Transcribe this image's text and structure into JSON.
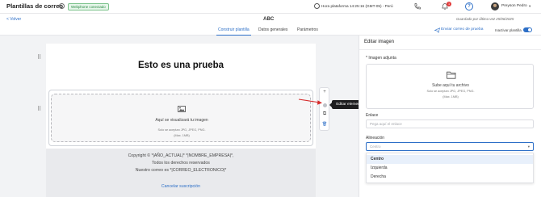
{
  "header": {
    "app_title": "Plantillas de correo",
    "status_badge": "Webphone conectado",
    "platform_time": "Hora plataforma 14:25:16 (GMT-05) - Perú",
    "notification_count": "1",
    "help_symbol": "?",
    "user_name": "Preyson Pedro"
  },
  "subheader": {
    "back": "< Volver",
    "title": "ABC",
    "saved": "Guardado por última vez 25/06/2025"
  },
  "tabs": {
    "items": [
      "Construir plantilla",
      "Datos generales",
      "Parámetros"
    ],
    "active": "Construir plantilla",
    "test_mail": "Enviar correo de prueba",
    "inactivate": "Inactivar plantilla"
  },
  "email": {
    "heading": "Esto es una prueba",
    "image_main": "Aquí se visualizará tu imagen",
    "image_sub1": "Solo se aceptan JPG, JPEG, PNG.",
    "image_sub2": "(Max. 1MB)",
    "footer_1": "Copyright © *|AÑO_ACTUAL|* *|NOMBRE_EMPRESA|*,",
    "footer_2": "Todos los derechos reservados",
    "footer_3": "Nuestro correo es *|CORREO_ELECTRONICO|*",
    "unsubscribe": "Cancelar suscripción"
  },
  "toolbar": {
    "add": "+",
    "copy": "⧉",
    "delete": "🗑",
    "tooltip": "Editar elemento"
  },
  "panel": {
    "title": "Editar imagen",
    "image_label": "* Imagen adjunta",
    "upload_main": "Sube aquí tu archivo",
    "upload_sub1": "Solo se aceptan JPG, JPEG, PNG.",
    "upload_sub2": "(Max. 1MB)",
    "link_label": "Enlace",
    "link_placeholder": "Pega aquí el enlace",
    "align_label": "Alineación",
    "align_placeholder": "Centro",
    "align_options": [
      "Centro",
      "Izquierda",
      "Derecha"
    ]
  },
  "colors": {
    "accent": "#2d6fc7",
    "badge_green": "#2a8a43",
    "notification": "#e23a3a",
    "arrow": "#d62b2b"
  }
}
